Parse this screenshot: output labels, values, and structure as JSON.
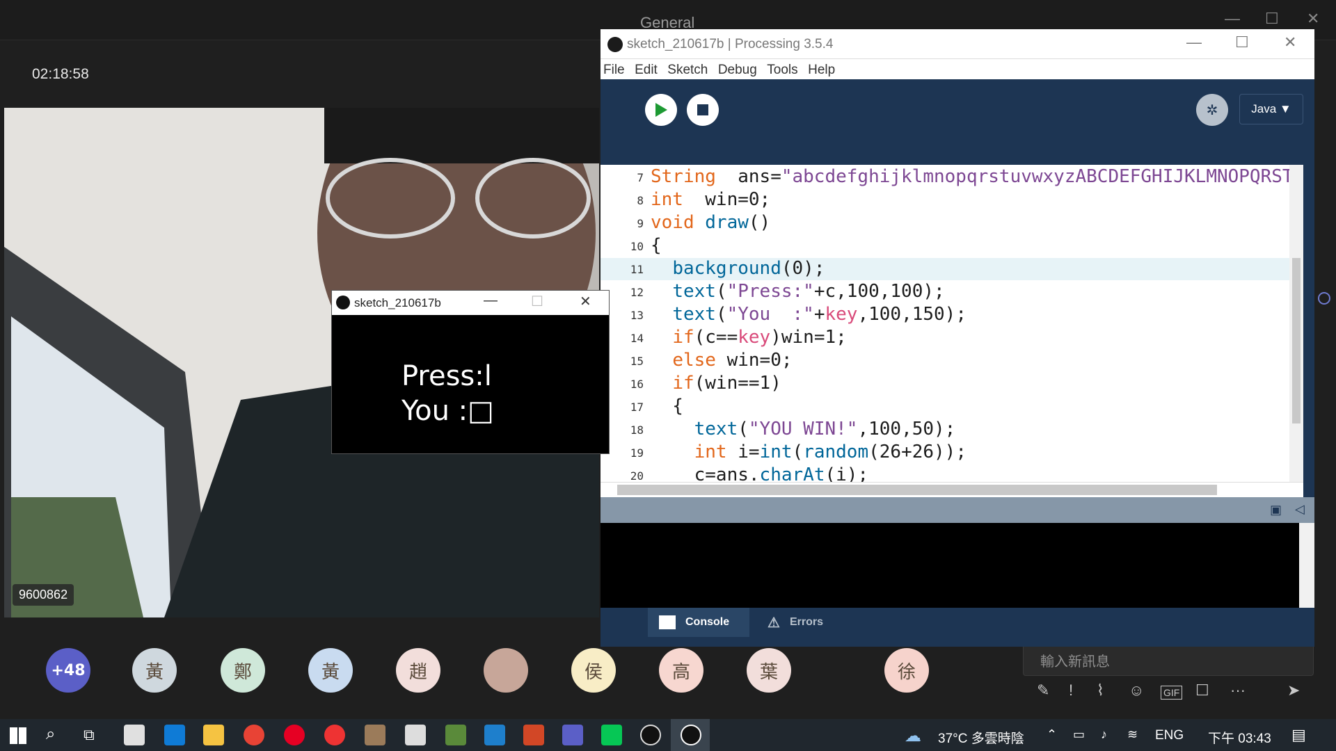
{
  "teams": {
    "channel_title": "General",
    "timer": "02:18:58",
    "participant_id": "9600862",
    "more_count": "+48",
    "avatars": [
      "黃",
      "鄭",
      "黃",
      "趙",
      "",
      "侯",
      "高",
      "葉",
      "徐"
    ],
    "chat_placeholder": "輸入新訊息"
  },
  "processing": {
    "title": "sketch_210617b | Processing 3.5.4",
    "menu": [
      "File",
      "Edit",
      "Sketch",
      "Debug",
      "Tools",
      "Help"
    ],
    "tab_name": "sketch_210617b",
    "mode": "Java ▼",
    "code": [
      {
        "line": "7",
        "tokens": [
          [
            "kw",
            "String"
          ],
          [
            "",
            "  ans="
          ],
          [
            "st",
            "\"abcdefghijklmnopqrstuvwxyzABCDEFGHIJKLMNOPQRSTUVW"
          ]
        ]
      },
      {
        "line": "8",
        "tokens": [
          [
            "kw",
            "int"
          ],
          [
            "",
            "  win=0;"
          ]
        ]
      },
      {
        "line": "9",
        "tokens": [
          [
            "kw",
            "void"
          ],
          [
            "",
            " "
          ],
          [
            "fn",
            "draw"
          ],
          [
            "",
            "()"
          ]
        ]
      },
      {
        "line": "10",
        "tokens": [
          [
            "",
            "{"
          ]
        ]
      },
      {
        "line": "11",
        "tokens": [
          [
            "",
            "  "
          ],
          [
            "fn",
            "background"
          ],
          [
            "",
            "(0);"
          ]
        ]
      },
      {
        "line": "12",
        "tokens": [
          [
            "",
            "  "
          ],
          [
            "fn",
            "text"
          ],
          [
            "",
            "("
          ],
          [
            "st",
            "\"Press:\""
          ],
          [
            "",
            "+c,100,100);"
          ]
        ]
      },
      {
        "line": "13",
        "tokens": [
          [
            "",
            "  "
          ],
          [
            "fn",
            "text"
          ],
          [
            "",
            "("
          ],
          [
            "st",
            "\"You  :\""
          ],
          [
            "",
            "+"
          ],
          [
            "ky",
            "key"
          ],
          [
            "",
            ",100,150);"
          ]
        ]
      },
      {
        "line": "14",
        "tokens": [
          [
            "",
            "  "
          ],
          [
            "kw",
            "if"
          ],
          [
            "",
            "(c=="
          ],
          [
            "ky",
            "key"
          ],
          [
            "",
            ")win=1;"
          ]
        ]
      },
      {
        "line": "15",
        "tokens": [
          [
            "",
            "  "
          ],
          [
            "kw",
            "else"
          ],
          [
            "",
            " win=0;"
          ]
        ]
      },
      {
        "line": "16",
        "tokens": [
          [
            "",
            "  "
          ],
          [
            "kw",
            "if"
          ],
          [
            "",
            "(win==1)"
          ]
        ]
      },
      {
        "line": "17",
        "tokens": [
          [
            "",
            "  {"
          ]
        ]
      },
      {
        "line": "18",
        "tokens": [
          [
            "",
            "    "
          ],
          [
            "fn",
            "text"
          ],
          [
            "",
            "("
          ],
          [
            "st",
            "\"YOU WIN!\""
          ],
          [
            "",
            ",100,50);"
          ]
        ]
      },
      {
        "line": "19",
        "tokens": [
          [
            "",
            "    "
          ],
          [
            "kw",
            "int"
          ],
          [
            "",
            " i="
          ],
          [
            "fn",
            "int"
          ],
          [
            "",
            "("
          ],
          [
            "fn",
            "random"
          ],
          [
            "",
            "(26+26));"
          ]
        ]
      },
      {
        "line": "20",
        "tokens": [
          [
            "",
            "    c=ans."
          ],
          [
            "fn",
            "charAt"
          ],
          [
            "",
            "(i);"
          ]
        ]
      }
    ],
    "console_tab": "Console",
    "errors_tab": "Errors"
  },
  "sketch_window": {
    "title": "sketch_210617b",
    "output_line1": "Press:l",
    "output_line2": "You  :□"
  },
  "taskbar": {
    "weather": "37°C  多雲時陰",
    "lang": "ENG",
    "clock": "下午 03:43"
  }
}
